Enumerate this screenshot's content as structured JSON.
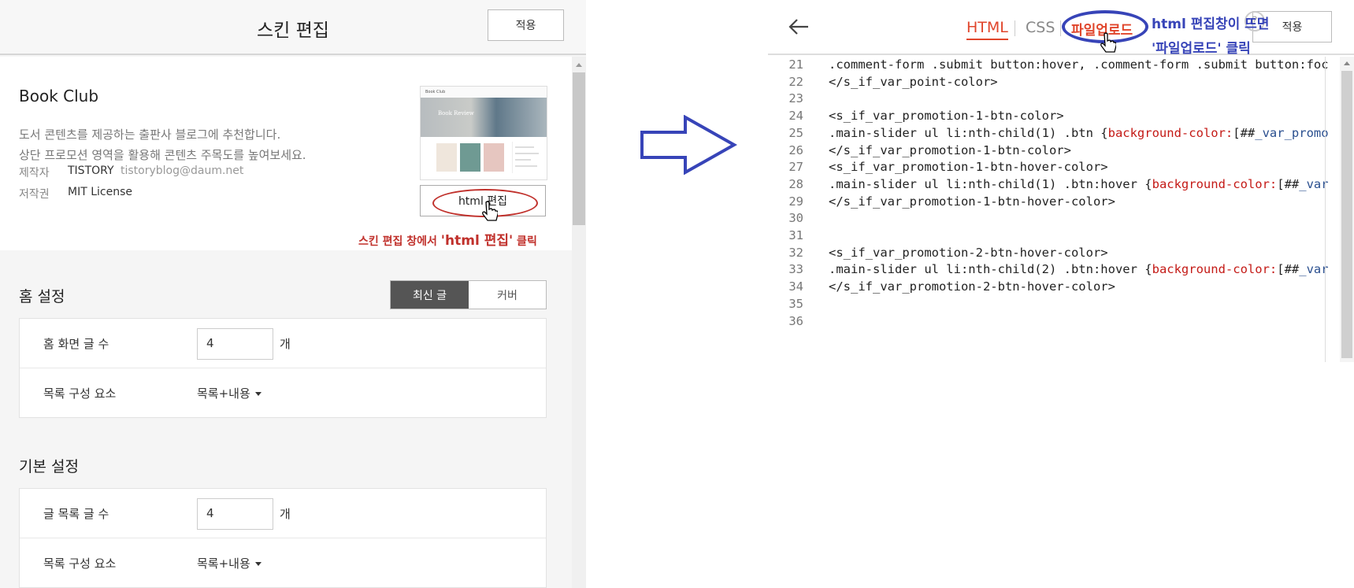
{
  "left": {
    "title": "스킨 편집",
    "apply_label": "적용",
    "skin": {
      "name": "Book Club",
      "desc_line1": "도서 콘텐츠를 제공하는 출판사 블로그에 추천합니다.",
      "desc_line2": "상단 프로모션 영역을 활용해 콘텐츠 주목도를 높여보세요.",
      "maker_key": "제작자",
      "maker_name": "TISTORY",
      "maker_email": "tistoryblog@daum.net",
      "license_key": "저작권",
      "license_value": "MIT License",
      "thumb_title": "Book Club",
      "thumb_hero_text": "Book Review"
    },
    "html_edit_label": "html 편집",
    "annotation_prefix": "스킨 편집 창에서 ",
    "annotation_bold": "'html 편집'",
    "annotation_suffix": " 클릭",
    "home": {
      "section_title": "홈 설정",
      "seg_on": "최신 글",
      "seg_off": "커버",
      "row1_label": "홈 화면 글 수",
      "row1_value": "4",
      "row1_unit": "개",
      "row2_label": "목록 구성 요소",
      "row2_value": "목록+내용"
    },
    "basic": {
      "section_title": "기본 설정",
      "row1_label": "글 목록 글 수",
      "row1_value": "4",
      "row1_unit": "개",
      "row2_label": "목록 구성 요소",
      "row2_value": "목록+내용"
    }
  },
  "right": {
    "tabs": {
      "html": "HTML",
      "css": "CSS",
      "upload": "파일업로드"
    },
    "help_label": "?",
    "apply_label": "적용",
    "annotation_line1": "html 편집창이 뜨면",
    "annotation_line2": "'파일업로드' 클릭",
    "code": [
      {
        "n": "21",
        "parts": [
          [
            "tag",
            ".comment-form .submit button:hover, .comment-form .submit button:foc"
          ]
        ]
      },
      {
        "n": "22",
        "parts": [
          [
            "tag",
            "</s_if_var_point-color>"
          ]
        ]
      },
      {
        "n": "23",
        "parts": []
      },
      {
        "n": "24",
        "parts": [
          [
            "tag",
            "<s_if_var_promotion-1-btn-color>"
          ]
        ]
      },
      {
        "n": "25",
        "parts": [
          [
            "tag",
            ".main-slider ul li:nth-child(1) .btn {"
          ],
          [
            "prop",
            "background-color:"
          ],
          [
            "tag",
            "[##"
          ],
          [
            "val",
            "_var_promo"
          ]
        ]
      },
      {
        "n": "26",
        "parts": [
          [
            "tag",
            "</s_if_var_promotion-1-btn-color>"
          ]
        ]
      },
      {
        "n": "27",
        "parts": [
          [
            "tag",
            "<s_if_var_promotion-1-btn-hover-color>"
          ]
        ]
      },
      {
        "n": "28",
        "parts": [
          [
            "tag",
            ".main-slider ul li:nth-child(1) .btn:hover {"
          ],
          [
            "prop",
            "background-color:"
          ],
          [
            "tag",
            "[##"
          ],
          [
            "val",
            "_var"
          ]
        ]
      },
      {
        "n": "29",
        "parts": [
          [
            "tag",
            "</s_if_var_promotion-1-btn-hover-color>"
          ]
        ]
      },
      {
        "n": "30",
        "parts": []
      },
      {
        "n": "31",
        "parts": []
      },
      {
        "n": "32",
        "parts": [
          [
            "tag",
            "<s_if_var_promotion-2-btn-hover-color>"
          ]
        ]
      },
      {
        "n": "33",
        "parts": [
          [
            "tag",
            ".main-slider ul li:nth-child(2) .btn:hover {"
          ],
          [
            "prop",
            "background-color:"
          ],
          [
            "tag",
            "[##"
          ],
          [
            "val",
            "_var"
          ]
        ]
      },
      {
        "n": "34",
        "parts": [
          [
            "tag",
            "</s_if_var_promotion-2-btn-hover-color>"
          ]
        ]
      },
      {
        "n": "35",
        "parts": []
      },
      {
        "n": "36",
        "parts": []
      }
    ]
  },
  "colors": {
    "accent_red": "#e0452b",
    "annotation_red": "#c0302b",
    "annotation_blue": "#3744b8"
  }
}
